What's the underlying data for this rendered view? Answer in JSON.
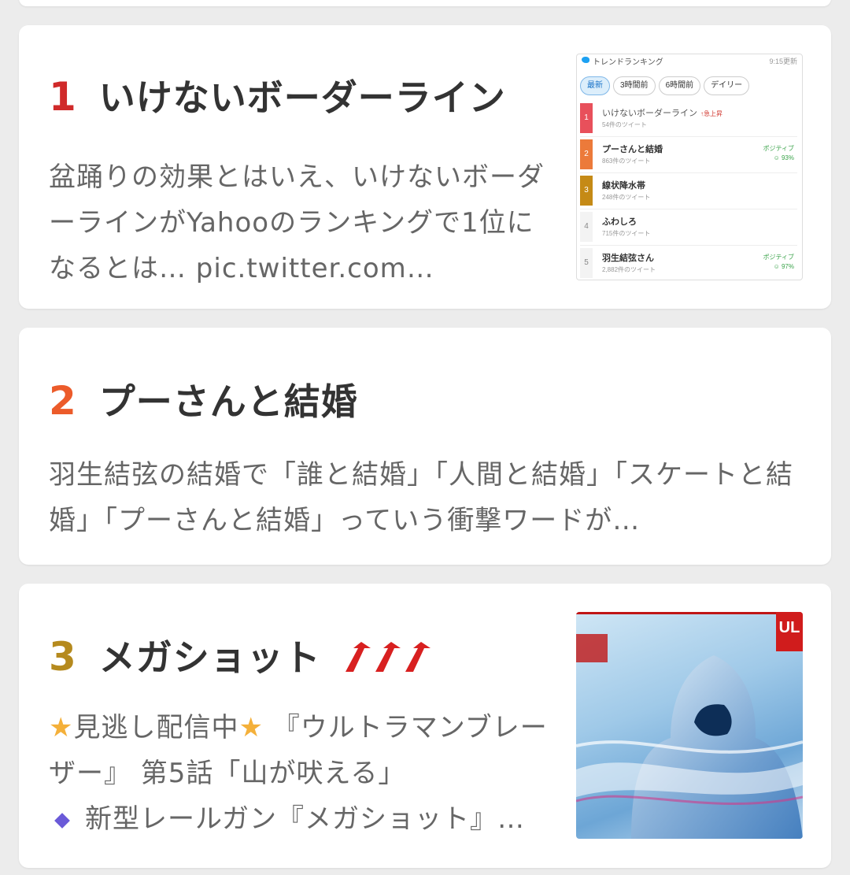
{
  "cards": [
    {
      "rank": "1",
      "title": "いけないボーダーライン",
      "body": "盆踊りの効果とはいえ、いけないボーダーラインがYahooのランキングで1位になるとは… pic.twitter.com…",
      "thumbnail": {
        "header": "トレンドランキング",
        "time": "9:15更新",
        "tabs": [
          "最新",
          "3時間前",
          "6時間前",
          "デイリー"
        ],
        "rows": [
          {
            "num": "1",
            "name": "いけないボーダーライン",
            "count": "54件のツイート",
            "tag": "急上昇",
            "color": "#e8505b"
          },
          {
            "num": "2",
            "name": "プーさんと結婚",
            "count": "863件のツイート",
            "badge": "ポジティブ",
            "pct": "93%",
            "color": "#ec7a3a"
          },
          {
            "num": "3",
            "name": "線状降水帯",
            "count": "248件のツイート",
            "color": "#c58a16"
          },
          {
            "num": "4",
            "name": "ふわしろ",
            "count": "715件のツイート",
            "color": "#f3f3f3"
          },
          {
            "num": "5",
            "name": "羽生結弦さん",
            "count": "2,882件のツイート",
            "badge": "ポジティブ",
            "pct": "97%",
            "color": "#f3f3f3"
          }
        ]
      }
    },
    {
      "rank": "2",
      "title": "プーさんと結婚",
      "body": "羽生結弦の結婚で「誰と結婚」「人間と結婚」「スケートと結婚」「プーさんと結婚」っていう衝撃ワードが…"
    },
    {
      "rank": "3",
      "title": "メガショット",
      "body_line1": "見逃し配信中",
      "body_line1b": " 『ウルトラマンブレーザー』 第5話「山が吠える」",
      "body_line2": "新型レールガン『メガショット』…",
      "thumbnail_badge": "UL"
    }
  ],
  "colors": {
    "rank1": "#d02a2a",
    "rank2": "#ec5b2a",
    "rank3": "#b58a1e",
    "arrow": "#d82020"
  }
}
